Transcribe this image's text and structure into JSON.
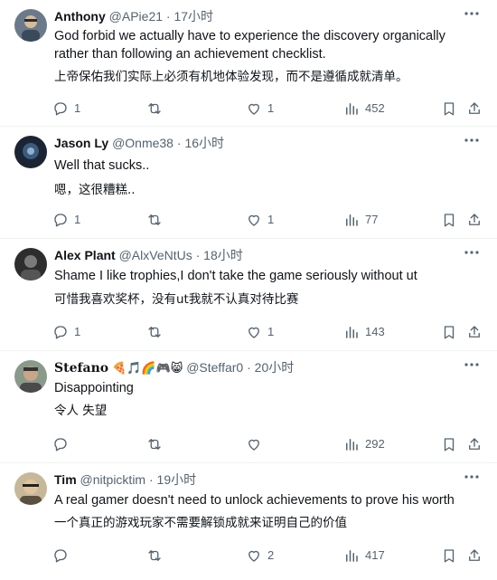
{
  "replies": [
    {
      "name": "Anthony",
      "handle": "@APie21",
      "separator": "·",
      "time": "17小时",
      "text": "God forbid we actually have to experience the discovery organically rather than following an achievement checklist.",
      "translation": "上帝保佑我们实际上必须有机地体验发现，而不是遵循成就清单。",
      "replies_count": "1",
      "retweets_count": "",
      "likes_count": "1",
      "views_count": "452"
    },
    {
      "name": "Jason Ly",
      "handle": "@Onme38",
      "separator": "·",
      "time": "16小时",
      "text": "Well that sucks..",
      "translation": "嗯，这很糟糕..",
      "replies_count": "1",
      "retweets_count": "",
      "likes_count": "1",
      "views_count": "77"
    },
    {
      "name": "Alex Plant",
      "handle": "@AlxVeNtUs",
      "separator": "·",
      "time": "18小时",
      "text": "Shame I like trophies,I don't take the game seriously without ut",
      "translation": "可惜我喜欢奖杯，没有ut我就不认真对待比赛",
      "replies_count": "1",
      "retweets_count": "",
      "likes_count": "1",
      "views_count": "143"
    },
    {
      "name": "Stefano",
      "name_emojis": "🍕🎵🌈🎮😸",
      "handle": "@Steffar0",
      "separator": "·",
      "time": "20小时",
      "text": "Disappointing",
      "translation": "令人 失望",
      "replies_count": "",
      "retweets_count": "",
      "likes_count": "",
      "views_count": "292"
    },
    {
      "name": "Tim",
      "handle": "@nitpicktim",
      "separator": "·",
      "time": "19小时",
      "text": "A real gamer doesn't need to unlock achievements to prove his worth",
      "translation": "一个真正的游戏玩家不需要解锁成就来证明自己的价值",
      "replies_count": "",
      "retweets_count": "",
      "likes_count": "2",
      "views_count": "417"
    }
  ],
  "icons": {
    "more": "more-dots-icon",
    "reply": "reply-icon",
    "retweet": "retweet-icon",
    "like": "like-icon",
    "views": "views-icon",
    "bookmark": "bookmark-icon",
    "share": "share-icon"
  },
  "colors": {
    "text": "#0f1419",
    "secondary": "#536471",
    "divider": "#eff3f4"
  }
}
